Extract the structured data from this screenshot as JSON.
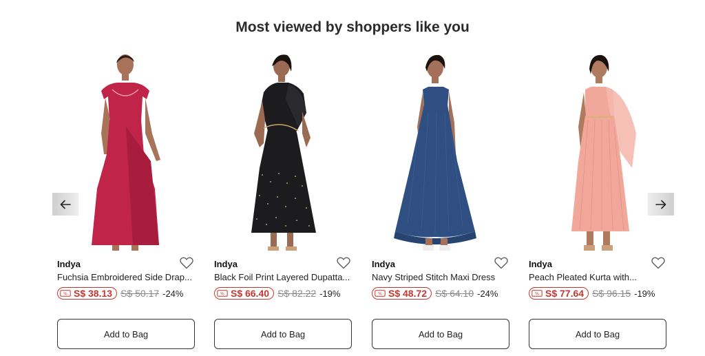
{
  "section": {
    "title": "Most viewed by shoppers like you"
  },
  "icons": {
    "prev": "arrow-left-icon",
    "next": "arrow-right-icon",
    "wishlist": "heart-outline-icon",
    "sale": "discount-tag-icon"
  },
  "colors": {
    "sale": "#c8362f",
    "text": "#222222",
    "muted": "#8a8a8a"
  },
  "products": [
    {
      "brand": "Indya",
      "name": "Fuchsia Embroidered Side Drap...",
      "sale_price": "S$ 38.13",
      "original_price": "S$ 50.17",
      "discount": "-24%",
      "button": "Add to Bag",
      "dress_color": "#c02448",
      "image": "woman-in-fuchsia-gown"
    },
    {
      "brand": "Indya",
      "name": "Black Foil Print Layered Dupatta...",
      "sale_price": "S$ 66.40",
      "original_price": "S$ 82.22",
      "discount": "-19%",
      "button": "Add to Bag",
      "dress_color": "#1c1c1f",
      "image": "woman-in-black-dress-with-dupatta"
    },
    {
      "brand": "Indya",
      "name": "Navy Striped Stitch Maxi Dress",
      "sale_price": "S$ 48.72",
      "original_price": "S$ 64.10",
      "discount": "-24%",
      "button": "Add to Bag",
      "dress_color": "#2f4f82",
      "image": "woman-in-navy-maxi-dress"
    },
    {
      "brand": "Indya",
      "name": "Peach Pleated Kurta with...",
      "sale_price": "S$ 77.64",
      "original_price": "S$ 96.15",
      "discount": "-19%",
      "button": "Add to Bag",
      "dress_color": "#f1a79a",
      "image": "woman-in-peach-kurta"
    }
  ]
}
